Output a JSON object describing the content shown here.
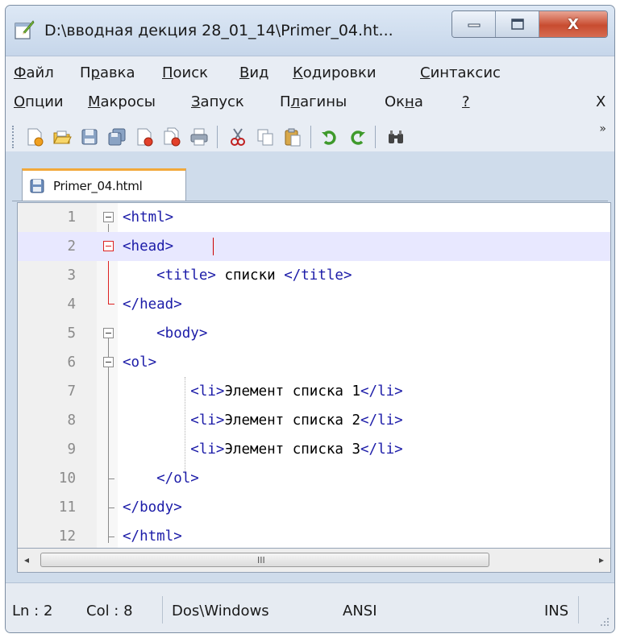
{
  "window": {
    "title": "D:\\вводная декция 28_01_14\\Primer_04.ht...",
    "close_glyph": "X"
  },
  "menu": {
    "row1": [
      {
        "label": "Файл",
        "underline": "Ф",
        "rest": "айл"
      },
      {
        "label": "Правка",
        "lead": "П",
        "underline": "р",
        "rest": "авка"
      },
      {
        "label": "Поиск",
        "underline": "П",
        "rest": "оиск"
      },
      {
        "label": "Вид",
        "underline": "В",
        "rest": "ид"
      },
      {
        "label": "Кодировки",
        "underline": "К",
        "rest": "одировки"
      },
      {
        "label": "Синтаксис",
        "underline": "С",
        "rest": "интаксис"
      }
    ],
    "row2": [
      {
        "label": "Опции",
        "underline": "О",
        "rest": "пции"
      },
      {
        "label": "Макросы",
        "underline": "М",
        "rest": "акросы"
      },
      {
        "label": "Запуск",
        "underline": "З",
        "rest": "апуск"
      },
      {
        "label": "Плагины",
        "lead": "П",
        "underline": "л",
        "rest": "агины"
      },
      {
        "label": "Окна",
        "lead": "Ок",
        "underline": "н",
        "rest": "а"
      },
      {
        "label": "?",
        "underline": "?",
        "rest": ""
      }
    ],
    "close_doc": "X"
  },
  "toolbar": {
    "icons": [
      "new-file-icon",
      "open-file-icon",
      "save-icon",
      "save-all-icon",
      "close-icon",
      "close-all-icon",
      "print-icon",
      "cut-icon",
      "copy-icon",
      "paste-icon",
      "undo-icon",
      "redo-icon",
      "find-icon"
    ],
    "more": "»"
  },
  "tab": {
    "label": "Primer_04.html"
  },
  "editor": {
    "lines": [
      {
        "n": "1",
        "code": "<html>"
      },
      {
        "n": "2",
        "code": "<head>"
      },
      {
        "n": "3",
        "code": "    <title> ",
        "text": "списки",
        "code2": " </title>"
      },
      {
        "n": "4",
        "code": "</head>"
      },
      {
        "n": "5",
        "code": "    <body>"
      },
      {
        "n": "6",
        "code": "<ol>"
      },
      {
        "n": "7",
        "code": "        <li>",
        "text": "Элемент списка 1",
        "code2": "</li>"
      },
      {
        "n": "8",
        "code": "        <li>",
        "text": "Элемент списка 2",
        "code2": "</li>"
      },
      {
        "n": "9",
        "code": "        <li>",
        "text": "Элемент списка 3",
        "code2": "</li>"
      },
      {
        "n": "10",
        "code": "    </ol>"
      },
      {
        "n": "11",
        "code": "</body>"
      },
      {
        "n": "12",
        "code": "</html>"
      }
    ]
  },
  "scrollbar": {
    "left_arrow": "◂",
    "right_arrow": "▸",
    "grip": "III"
  },
  "status": {
    "ln": "Ln : 2",
    "col": "Col : 8",
    "eol": "Dos\\Windows",
    "encoding": "ANSI",
    "mode": "INS"
  },
  "colors": {
    "tag": "#1c1ca8",
    "current_line": "#e8e8ff",
    "fold_active": "#dd2222",
    "tab_accent": "#f2a93b"
  }
}
